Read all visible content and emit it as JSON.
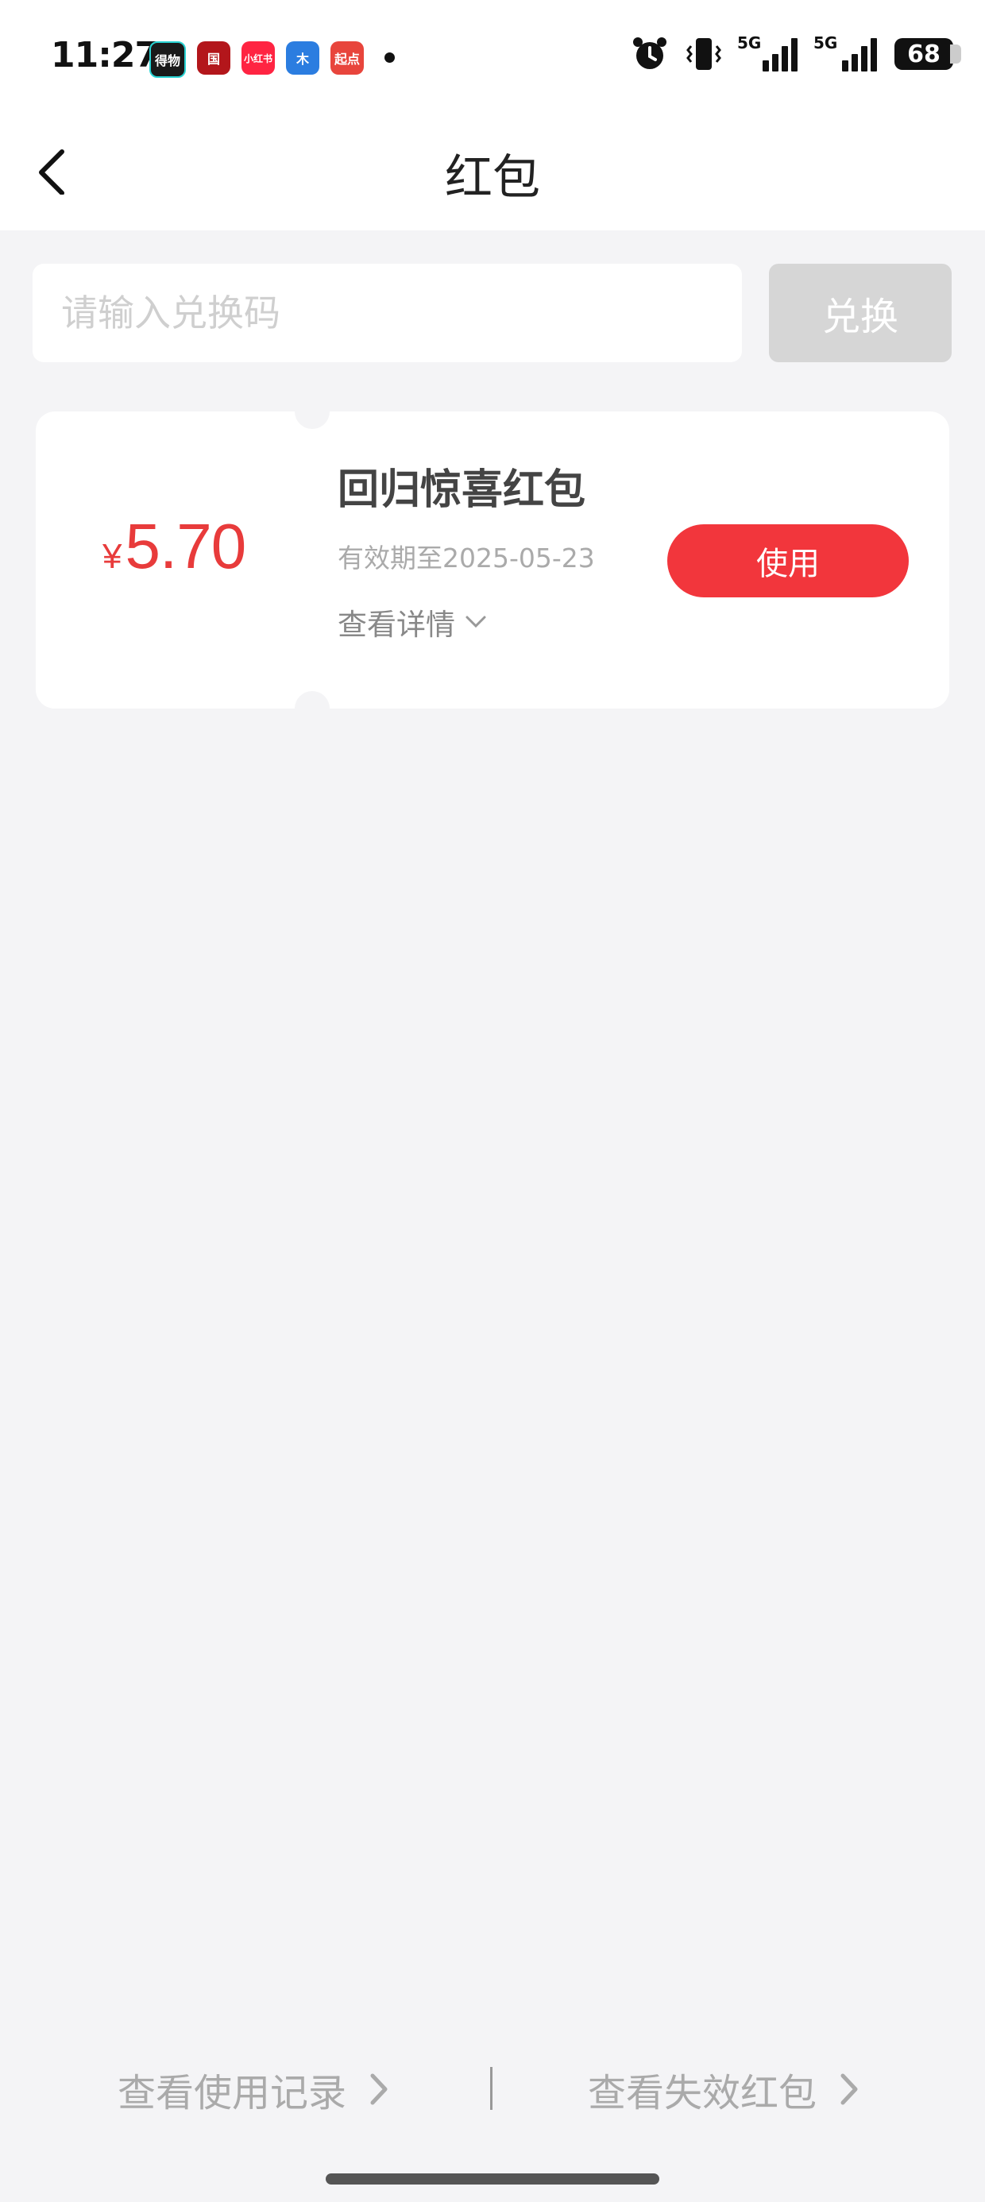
{
  "status_bar": {
    "time": "11:27",
    "battery": "68",
    "signal_label_1": "5G",
    "signal_label_2": "5G",
    "app_icons": [
      {
        "label": "得物",
        "color": "#1a1a1a"
      },
      {
        "label": "国",
        "color": "#b3161b"
      },
      {
        "label": "小红书",
        "color": "#ff2442"
      },
      {
        "label": "木",
        "color": "#2b7de0"
      },
      {
        "label": "起点",
        "color": "#e8453c"
      }
    ]
  },
  "nav": {
    "title": "红包",
    "back_icon": "chevron-left-icon"
  },
  "redeem": {
    "placeholder": "请输入兑换码",
    "value": "",
    "button_label": "兑换"
  },
  "coupon": {
    "currency": "¥",
    "amount": "5.70",
    "title": "回归惊喜红包",
    "expiry": "有效期至2025-05-23",
    "details_label": "查看详情",
    "use_label": "使用"
  },
  "footer": {
    "history_link": "查看使用记录",
    "expired_link": "查看失效红包"
  },
  "colors": {
    "accent": "#f2363c",
    "amount": "#e83b3b",
    "disabled_button": "#d6d6d6",
    "background": "#f4f4f6"
  }
}
